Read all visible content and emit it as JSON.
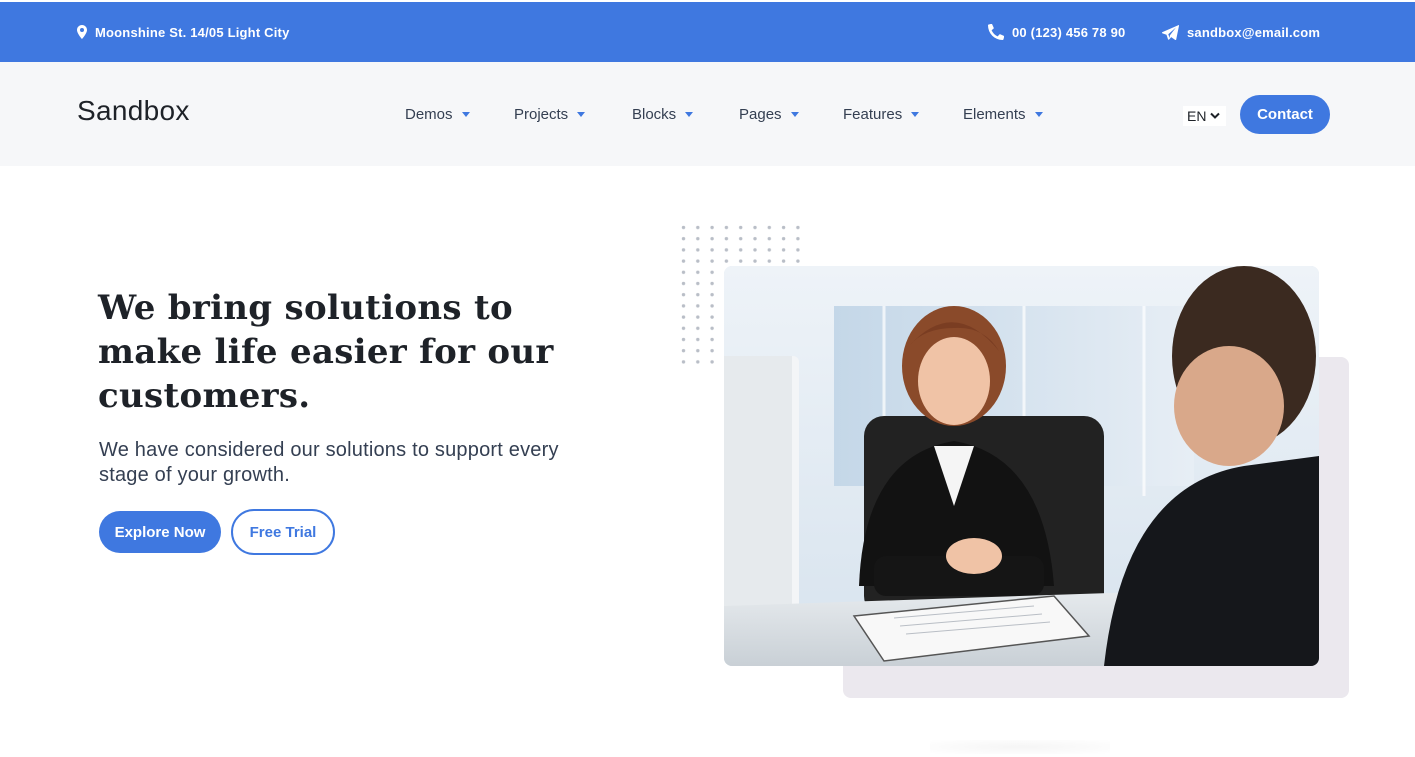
{
  "topbar": {
    "address": "Moonshine St. 14/05 Light City",
    "phone": "00 (123) 456 78 90",
    "email": "sandbox@email.com",
    "icons": [
      "map-pin-icon",
      "phone-icon",
      "paper-plane-icon"
    ]
  },
  "navbar": {
    "logo": "Sandbox",
    "items": [
      {
        "label": "Demos"
      },
      {
        "label": "Projects"
      },
      {
        "label": "Blocks"
      },
      {
        "label": "Pages"
      },
      {
        "label": "Features"
      },
      {
        "label": "Elements"
      }
    ],
    "language": "EN",
    "contact_label": "Contact"
  },
  "hero": {
    "title": "We bring solutions to make life easier for our customers.",
    "subtitle": "We have considered our solutions to support every stage of your growth.",
    "primary_button": "Explore Now",
    "secondary_button": "Free Trial"
  },
  "colors": {
    "brand": "#3f78e0",
    "navbar_bg": "#f6f7f9",
    "heading": "#1e2228",
    "body_text": "#343f52",
    "accent_panel": "#ebe8ee"
  }
}
